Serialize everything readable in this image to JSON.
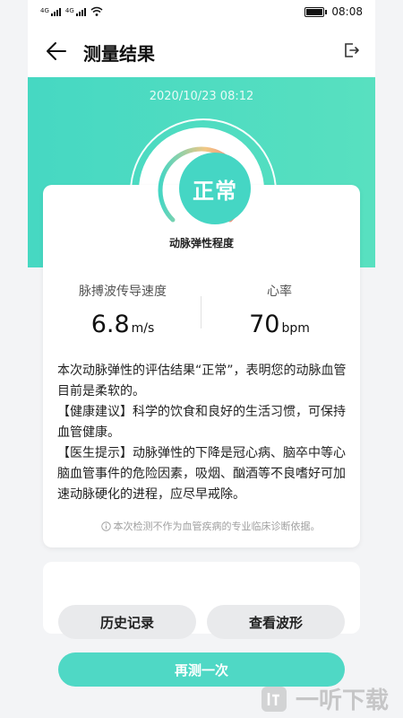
{
  "status_bar": {
    "sim1_label": "4G",
    "sim2_label": "4G",
    "time": "08:08"
  },
  "header": {
    "title": "测量结果"
  },
  "measurement": {
    "datetime": "2020/10/23 08:12",
    "result": "正常",
    "gauge_label": "动脉弹性程度",
    "pwv_label": "脉搏波传导速度",
    "pwv_value": "6.8",
    "pwv_unit": "m/s",
    "hr_label": "心率",
    "hr_value": "70",
    "hr_unit": "bpm"
  },
  "description": {
    "summary": "本次动脉弹性的评估结果“正常”，表明您的动脉血管目前是柔软的。",
    "health_advice": "【健康建议】科学的饮食和良好的生活习惯，可保持血管健康。",
    "doctor_tip": "【医生提示】动脉弹性的下降是冠心病、脑卒中等心脑血管事件的危险因素，吸烟、酗酒等不良嗜好可加速动脉硬化的进程，应尽早戒除。"
  },
  "disclaimer": "本次检测不作为血管疾病的专业临床诊断依据。",
  "buttons": {
    "history": "历史记录",
    "waveform": "查看波形",
    "remeasure": "再测一次"
  },
  "watermark": "一听下载",
  "colors": {
    "accent": "#4fd8c5",
    "gauge_warm": "#f07b7b",
    "gauge_mid": "#f2c884"
  }
}
